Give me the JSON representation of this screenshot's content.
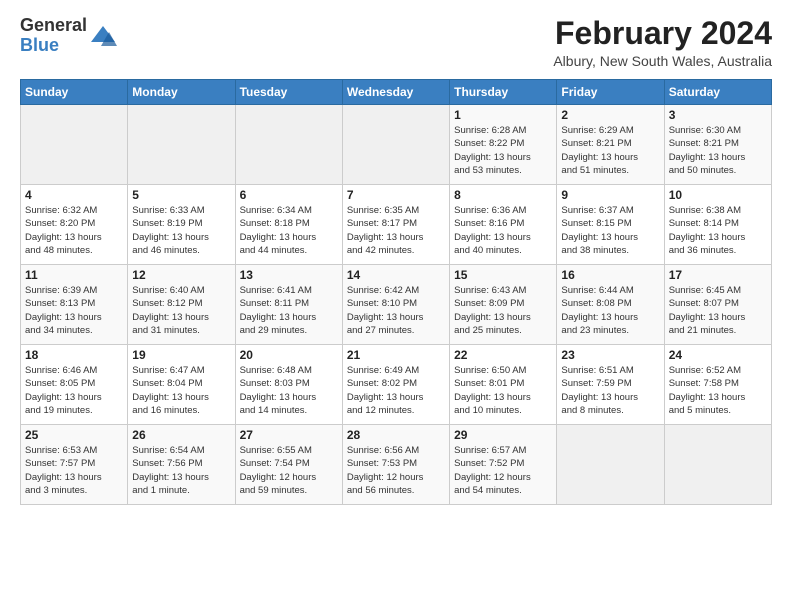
{
  "logo": {
    "general": "General",
    "blue": "Blue"
  },
  "title": "February 2024",
  "subtitle": "Albury, New South Wales, Australia",
  "days_of_week": [
    "Sunday",
    "Monday",
    "Tuesday",
    "Wednesday",
    "Thursday",
    "Friday",
    "Saturday"
  ],
  "weeks": [
    [
      {
        "day": "",
        "info": ""
      },
      {
        "day": "",
        "info": ""
      },
      {
        "day": "",
        "info": ""
      },
      {
        "day": "",
        "info": ""
      },
      {
        "day": "1",
        "info": "Sunrise: 6:28 AM\nSunset: 8:22 PM\nDaylight: 13 hours\nand 53 minutes."
      },
      {
        "day": "2",
        "info": "Sunrise: 6:29 AM\nSunset: 8:21 PM\nDaylight: 13 hours\nand 51 minutes."
      },
      {
        "day": "3",
        "info": "Sunrise: 6:30 AM\nSunset: 8:21 PM\nDaylight: 13 hours\nand 50 minutes."
      }
    ],
    [
      {
        "day": "4",
        "info": "Sunrise: 6:32 AM\nSunset: 8:20 PM\nDaylight: 13 hours\nand 48 minutes."
      },
      {
        "day": "5",
        "info": "Sunrise: 6:33 AM\nSunset: 8:19 PM\nDaylight: 13 hours\nand 46 minutes."
      },
      {
        "day": "6",
        "info": "Sunrise: 6:34 AM\nSunset: 8:18 PM\nDaylight: 13 hours\nand 44 minutes."
      },
      {
        "day": "7",
        "info": "Sunrise: 6:35 AM\nSunset: 8:17 PM\nDaylight: 13 hours\nand 42 minutes."
      },
      {
        "day": "8",
        "info": "Sunrise: 6:36 AM\nSunset: 8:16 PM\nDaylight: 13 hours\nand 40 minutes."
      },
      {
        "day": "9",
        "info": "Sunrise: 6:37 AM\nSunset: 8:15 PM\nDaylight: 13 hours\nand 38 minutes."
      },
      {
        "day": "10",
        "info": "Sunrise: 6:38 AM\nSunset: 8:14 PM\nDaylight: 13 hours\nand 36 minutes."
      }
    ],
    [
      {
        "day": "11",
        "info": "Sunrise: 6:39 AM\nSunset: 8:13 PM\nDaylight: 13 hours\nand 34 minutes."
      },
      {
        "day": "12",
        "info": "Sunrise: 6:40 AM\nSunset: 8:12 PM\nDaylight: 13 hours\nand 31 minutes."
      },
      {
        "day": "13",
        "info": "Sunrise: 6:41 AM\nSunset: 8:11 PM\nDaylight: 13 hours\nand 29 minutes."
      },
      {
        "day": "14",
        "info": "Sunrise: 6:42 AM\nSunset: 8:10 PM\nDaylight: 13 hours\nand 27 minutes."
      },
      {
        "day": "15",
        "info": "Sunrise: 6:43 AM\nSunset: 8:09 PM\nDaylight: 13 hours\nand 25 minutes."
      },
      {
        "day": "16",
        "info": "Sunrise: 6:44 AM\nSunset: 8:08 PM\nDaylight: 13 hours\nand 23 minutes."
      },
      {
        "day": "17",
        "info": "Sunrise: 6:45 AM\nSunset: 8:07 PM\nDaylight: 13 hours\nand 21 minutes."
      }
    ],
    [
      {
        "day": "18",
        "info": "Sunrise: 6:46 AM\nSunset: 8:05 PM\nDaylight: 13 hours\nand 19 minutes."
      },
      {
        "day": "19",
        "info": "Sunrise: 6:47 AM\nSunset: 8:04 PM\nDaylight: 13 hours\nand 16 minutes."
      },
      {
        "day": "20",
        "info": "Sunrise: 6:48 AM\nSunset: 8:03 PM\nDaylight: 13 hours\nand 14 minutes."
      },
      {
        "day": "21",
        "info": "Sunrise: 6:49 AM\nSunset: 8:02 PM\nDaylight: 13 hours\nand 12 minutes."
      },
      {
        "day": "22",
        "info": "Sunrise: 6:50 AM\nSunset: 8:01 PM\nDaylight: 13 hours\nand 10 minutes."
      },
      {
        "day": "23",
        "info": "Sunrise: 6:51 AM\nSunset: 7:59 PM\nDaylight: 13 hours\nand 8 minutes."
      },
      {
        "day": "24",
        "info": "Sunrise: 6:52 AM\nSunset: 7:58 PM\nDaylight: 13 hours\nand 5 minutes."
      }
    ],
    [
      {
        "day": "25",
        "info": "Sunrise: 6:53 AM\nSunset: 7:57 PM\nDaylight: 13 hours\nand 3 minutes."
      },
      {
        "day": "26",
        "info": "Sunrise: 6:54 AM\nSunset: 7:56 PM\nDaylight: 13 hours\nand 1 minute."
      },
      {
        "day": "27",
        "info": "Sunrise: 6:55 AM\nSunset: 7:54 PM\nDaylight: 12 hours\nand 59 minutes."
      },
      {
        "day": "28",
        "info": "Sunrise: 6:56 AM\nSunset: 7:53 PM\nDaylight: 12 hours\nand 56 minutes."
      },
      {
        "day": "29",
        "info": "Sunrise: 6:57 AM\nSunset: 7:52 PM\nDaylight: 12 hours\nand 54 minutes."
      },
      {
        "day": "",
        "info": ""
      },
      {
        "day": "",
        "info": ""
      }
    ]
  ]
}
